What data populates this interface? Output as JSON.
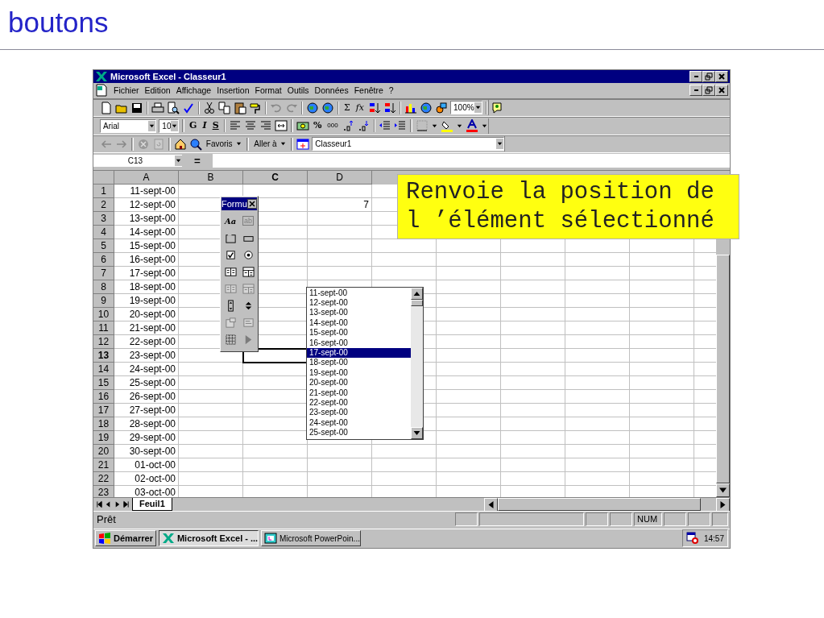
{
  "slide": {
    "title": "boutons"
  },
  "window": {
    "title": "Microsoft Excel - Classeur1"
  },
  "menu": [
    "Fichier",
    "Edition",
    "Affichage",
    "Insertion",
    "Format",
    "Outils",
    "Données",
    "Fenêtre",
    "?"
  ],
  "standard_toolbar": {
    "sum": "Σ",
    "function": "fx",
    "zoom": "100%"
  },
  "format_toolbar": {
    "font": "Arial",
    "size": "10",
    "bold": "G",
    "italic": "I",
    "underline": "S",
    "percent": "%",
    "thousands": "000"
  },
  "web_toolbar": {
    "favorites": "Favoris",
    "goto": "Aller à",
    "address": "Classeur1"
  },
  "formula_bar": {
    "name_box": "C13",
    "equals": "="
  },
  "sheet": {
    "columns": [
      {
        "label": "A",
        "selected": false
      },
      {
        "label": "B",
        "selected": false
      },
      {
        "label": "C",
        "selected": true
      },
      {
        "label": "D",
        "selected": false
      }
    ],
    "rows": [
      {
        "header": "1",
        "selected": false,
        "col_a": "11-sept-00"
      },
      {
        "header": "2",
        "selected": false,
        "col_a": "12-sept-00",
        "col_d": "7"
      },
      {
        "header": "3",
        "selected": false,
        "col_a": "13-sept-00"
      },
      {
        "header": "4",
        "selected": false,
        "col_a": "14-sept-00"
      },
      {
        "header": "5",
        "selected": false,
        "col_a": "15-sept-00"
      },
      {
        "header": "6",
        "selected": false,
        "col_a": "16-sept-00"
      },
      {
        "header": "7",
        "selected": false,
        "col_a": "17-sept-00"
      },
      {
        "header": "8",
        "selected": false,
        "col_a": "18-sept-00"
      },
      {
        "header": "9",
        "selected": false,
        "col_a": "19-sept-00"
      },
      {
        "header": "10",
        "selected": false,
        "col_a": "20-sept-00"
      },
      {
        "header": "11",
        "selected": false,
        "col_a": "21-sept-00"
      },
      {
        "header": "12",
        "selected": false,
        "col_a": "22-sept-00"
      },
      {
        "header": "13",
        "selected": true,
        "col_a": "23-sept-00"
      },
      {
        "header": "14",
        "selected": false,
        "col_a": "24-sept-00"
      },
      {
        "header": "15",
        "selected": false,
        "col_a": "25-sept-00"
      },
      {
        "header": "16",
        "selected": false,
        "col_a": "26-sept-00"
      },
      {
        "header": "17",
        "selected": false,
        "col_a": "27-sept-00"
      },
      {
        "header": "18",
        "selected": false,
        "col_a": "28-sept-00"
      },
      {
        "header": "19",
        "selected": false,
        "col_a": "29-sept-00"
      },
      {
        "header": "20",
        "selected": false,
        "col_a": "30-sept-00"
      },
      {
        "header": "21",
        "selected": false,
        "col_a": "01-oct-00"
      },
      {
        "header": "22",
        "selected": false,
        "col_a": "02-oct-00"
      },
      {
        "header": "23",
        "selected": false,
        "col_a": "03-oct-00"
      }
    ]
  },
  "forms_toolbar": {
    "title": "Formu",
    "tools": [
      {
        "kind": "label",
        "text": "Aa",
        "disabled": false
      },
      {
        "kind": "edit",
        "text": "ab",
        "disabled": true
      },
      {
        "kind": "groupbox",
        "disabled": false
      },
      {
        "kind": "button",
        "disabled": false
      },
      {
        "kind": "checkbox",
        "disabled": false
      },
      {
        "kind": "radio",
        "disabled": false
      },
      {
        "kind": "listbox",
        "disabled": false
      },
      {
        "kind": "combo",
        "disabled": false
      },
      {
        "kind": "listbox",
        "disabled": true
      },
      {
        "kind": "combo",
        "disabled": true
      },
      {
        "kind": "scrollbar",
        "disabled": false
      },
      {
        "kind": "spinner",
        "disabled": false
      },
      {
        "kind": "properties",
        "disabled": true
      },
      {
        "kind": "code",
        "disabled": true
      },
      {
        "kind": "grid",
        "disabled": false
      },
      {
        "kind": "run",
        "disabled": true
      }
    ]
  },
  "listbox": {
    "items": [
      {
        "text": "11-sept-00",
        "selected": false
      },
      {
        "text": "12-sept-00",
        "selected": false
      },
      {
        "text": "13-sept-00",
        "selected": false
      },
      {
        "text": "14-sept-00",
        "selected": false
      },
      {
        "text": "15-sept-00",
        "selected": false
      },
      {
        "text": "16-sept-00",
        "selected": false
      },
      {
        "text": "17-sept-00",
        "selected": true
      },
      {
        "text": "18-sept-00",
        "selected": false
      },
      {
        "text": "19-sept-00",
        "selected": false
      },
      {
        "text": "20-sept-00",
        "selected": false
      },
      {
        "text": "21-sept-00",
        "selected": false
      },
      {
        "text": "22-sept-00",
        "selected": false
      },
      {
        "text": "23-sept-00",
        "selected": false
      },
      {
        "text": "24-sept-00",
        "selected": false
      },
      {
        "text": "25-sept-00",
        "selected": false
      }
    ]
  },
  "callout": {
    "text": "Renvoie la position de l ’élément sélectionné"
  },
  "sheet_tabs": [
    {
      "label": "Feuil1",
      "selected": true
    }
  ],
  "status_bar": {
    "text": "Prêt",
    "num": "NUM"
  },
  "taskbar": {
    "start": "Démarrer",
    "tasks": [
      {
        "label": "Microsoft Excel - ...",
        "selected": true,
        "kind": "excel"
      },
      {
        "label": "Microsoft PowerPoin...",
        "selected": false,
        "kind": "slides"
      }
    ],
    "clock": "14:57"
  }
}
